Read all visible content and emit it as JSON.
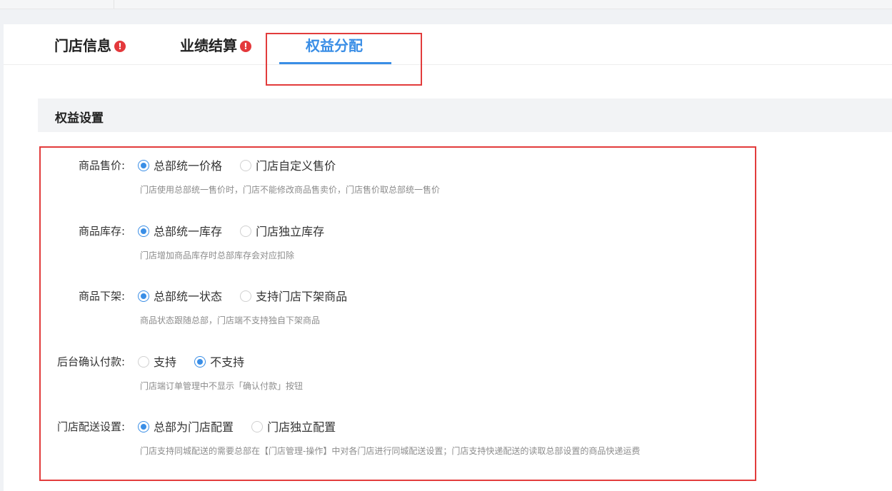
{
  "tabs": [
    {
      "label": "门店信息",
      "warning": "!"
    },
    {
      "label": "业绩结算",
      "warning": "!"
    },
    {
      "label": "权益分配"
    }
  ],
  "section": {
    "title": "权益设置"
  },
  "settings": [
    {
      "label": "商品售价:",
      "options": [
        "总部统一价格",
        "门店自定义售价"
      ],
      "hint": "门店使用总部统一售价时，门店不能修改商品售卖价，门店售价取总部统一售价"
    },
    {
      "label": "商品库存:",
      "options": [
        "总部统一库存",
        "门店独立库存"
      ],
      "hint": "门店增加商品库存时总部库存会对应扣除"
    },
    {
      "label": "商品下架:",
      "options": [
        "总部统一状态",
        "支持门店下架商品"
      ],
      "hint": "商品状态跟随总部，门店端不支持独自下架商品"
    },
    {
      "label": "后台确认付款:",
      "options": [
        "支持",
        "不支持"
      ],
      "hint": "门店端订单管理中不显示「确认付款」按钮"
    },
    {
      "label": "门店配送设置:",
      "options": [
        "总部为门店配置",
        "门店独立配置"
      ],
      "hint": "门店支持同城配送的需要总部在【门店管理-操作】中对各门店进行同城配送设置；门店支持快递配送的读取总部设置的商品快递运费"
    }
  ],
  "colors": {
    "accent": "#3a8ee6",
    "highlight": "#e23c3c",
    "warning": "#e4393c"
  }
}
